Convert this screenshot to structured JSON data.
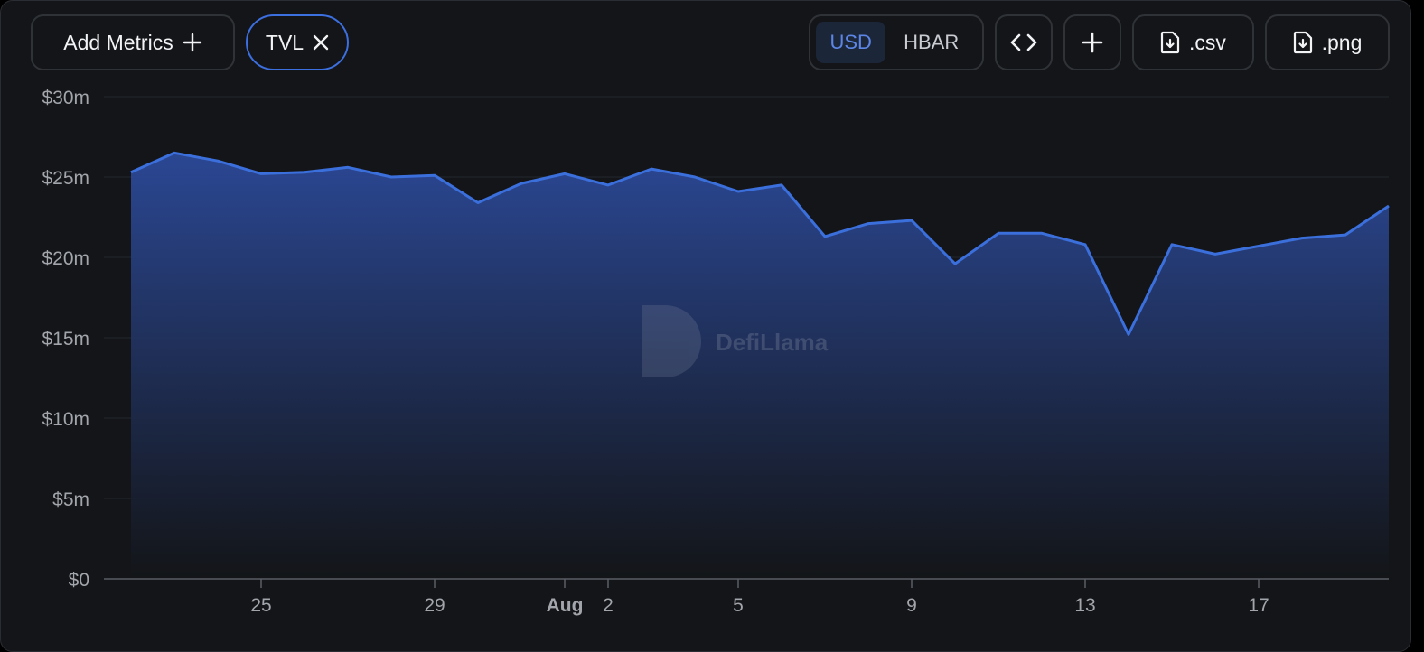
{
  "toolbar": {
    "add_metrics_label": "Add Metrics",
    "metric_chip_label": "TVL",
    "currency_options": [
      "USD",
      "HBAR"
    ],
    "currency_selected": "USD",
    "csv_label": ".csv",
    "png_label": ".png"
  },
  "colors": {
    "line": "#3b6fdb",
    "area_top": "#2c4a9a",
    "accent": "#5c86e5"
  },
  "watermark": {
    "text": "DefiLlama"
  },
  "chart_data": {
    "type": "area",
    "x": [
      "2024-07-22",
      "2024-07-23",
      "2024-07-24",
      "2024-07-25",
      "2024-07-26",
      "2024-07-27",
      "2024-07-28",
      "2024-07-29",
      "2024-07-30",
      "2024-07-31",
      "2024-08-01",
      "2024-08-02",
      "2024-08-03",
      "2024-08-04",
      "2024-08-05",
      "2024-08-06",
      "2024-08-07",
      "2024-08-08",
      "2024-08-09",
      "2024-08-10",
      "2024-08-11",
      "2024-08-12",
      "2024-08-13",
      "2024-08-14",
      "2024-08-15",
      "2024-08-16",
      "2024-08-17",
      "2024-08-18",
      "2024-08-19",
      "2024-08-20"
    ],
    "series": [
      {
        "values": [
          25.3,
          26.5,
          26.0,
          25.2,
          25.3,
          25.6,
          25.0,
          25.1,
          23.4,
          24.6,
          25.2,
          24.5,
          25.5,
          25.0,
          24.1,
          24.5,
          21.3,
          22.1,
          22.3,
          19.6,
          21.5,
          21.5,
          20.8,
          15.2,
          20.8,
          20.2,
          20.7,
          21.2,
          21.4,
          23.2
        ]
      }
    ],
    "unit": "$ millions",
    "ylim": [
      0,
      30
    ],
    "y_ticks": [
      "$0",
      "$5m",
      "$10m",
      "$15m",
      "$20m",
      "$25m",
      "$30m"
    ],
    "x_ticks": [
      {
        "date": "2024-07-25",
        "label": "25",
        "bold": false
      },
      {
        "date": "2024-07-29",
        "label": "29",
        "bold": false
      },
      {
        "date": "2024-08-01",
        "label": "Aug",
        "bold": true
      },
      {
        "date": "2024-08-02",
        "label": "2",
        "bold": false
      },
      {
        "date": "2024-08-05",
        "label": "5",
        "bold": false
      },
      {
        "date": "2024-08-09",
        "label": "9",
        "bold": false
      },
      {
        "date": "2024-08-13",
        "label": "13",
        "bold": false
      },
      {
        "date": "2024-08-17",
        "label": "17",
        "bold": false
      }
    ],
    "grid": true,
    "legend": "none"
  }
}
